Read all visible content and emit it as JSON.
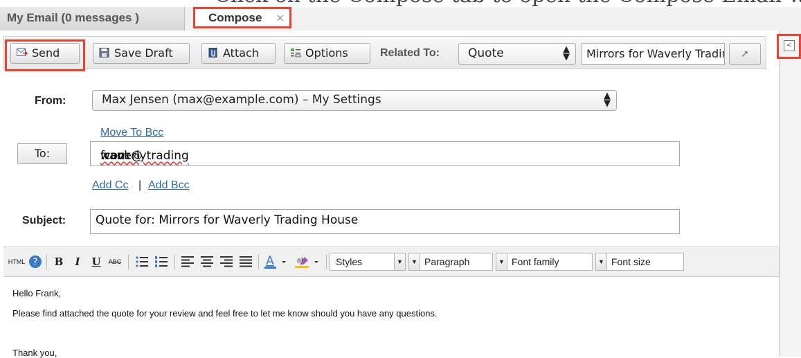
{
  "caption": "Click on the Compose tab to open the Compose Email window.",
  "tabs": {
    "inbox_label": "My Email (0 messages )",
    "compose_label": "Compose",
    "close_glyph": "×"
  },
  "toolbar": {
    "send": "Send",
    "save_draft": "Save Draft",
    "attach": "Attach",
    "options": "Options",
    "related_to_label": "Related To:",
    "related_type": "Quote",
    "related_record": "Mirrors for Waverly Trading House"
  },
  "form": {
    "from_label": "From:",
    "from_value": "Max Jensen (max@example.com) – My Settings",
    "move_to_bcc": "Move To Bcc",
    "to_button": "To:",
    "to_value_prefix": "frank@",
    "to_value_misspelled": "waverlytrading",
    "to_value_suffix": ".com",
    "add_cc": "Add Cc",
    "separator": "|",
    "add_bcc": "Add Bcc",
    "subject_label": "Subject:",
    "subject_value": "Quote for: Mirrors for Waverly Trading House"
  },
  "editor": {
    "html_label": "HTML",
    "bold": "B",
    "italic": "I",
    "underline": "U",
    "strike": "ABC",
    "styles": "Styles",
    "paragraph": "Paragraph",
    "font_family": "Font family",
    "font_size": "Font size"
  },
  "body": {
    "line1": "Hello Frank,",
    "line2": "Please find attached the quote for your review and feel free to let me know should you have any questions.",
    "line3": "Thank you,"
  },
  "colors": {
    "highlight": "#e8442f",
    "link": "#2a6ab8"
  }
}
